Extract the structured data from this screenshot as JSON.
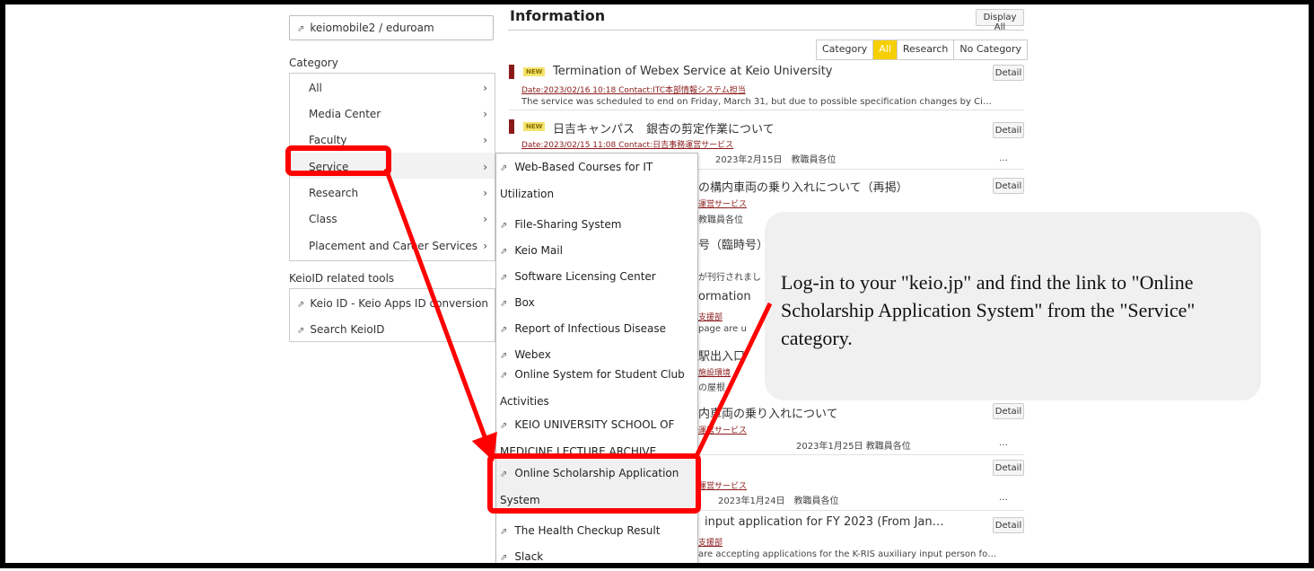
{
  "left": {
    "wifi_label": "keiomobile2 / eduroam",
    "category_heading": "Category",
    "categories": [
      "All",
      "Media Center",
      "Faculty",
      "Service",
      "Research",
      "Class",
      "Placement and Career Services"
    ],
    "tools_heading": "KeioID related tools",
    "tools": [
      "Keio ID - Keio Apps ID conversion",
      "Search KeioID"
    ]
  },
  "submenu": {
    "items": [
      "Web-Based Courses for IT Utilization",
      "File-Sharing System",
      "Keio Mail",
      "Software Licensing Center",
      "Box",
      "Report of Infectious Disease",
      "Webex",
      "Online System for Student Club Activities",
      "KEIO UNIVERSITY SCHOOL OF MEDICINE LECTURE ARCHIVE",
      "Online Scholarship Application System",
      "The Health Checkup Result",
      "Slack"
    ]
  },
  "info": {
    "title": "Information",
    "display_all": "Display All",
    "filters": [
      "Category",
      "All",
      "Research",
      "No Category"
    ],
    "detail_label": "Detail",
    "new_badge": "NEW",
    "news": [
      {
        "title": "Termination of Webex Service at Keio University",
        "meta": "Date:2023/02/16 10:18   Contact:ITC本部情報システム担当",
        "summary": "The service was scheduled to end on Friday, March 31, but due to possible specification changes by Ci…"
      },
      {
        "title": "日吉キャンパス　銀杏の剪定作業について",
        "meta": "Date:2023/02/15 11:08   Contact:日吉事務運営サービス",
        "summary": "2023年2月15日　教職員各位"
      }
    ],
    "fragments": {
      "f1_title": "の構内車両の乗り入れについて（再掲）",
      "f1_link": "運営サービス",
      "f1_text": "教職員各位",
      "f2_title": "号（臨時号）の",
      "f2_text": "が刊行されまし",
      "f3_title": "ormation",
      "f3_link": "支援部",
      "f3_text": "page are u",
      "f4_title": "駅出入口",
      "f4_link": "施設環境",
      "f4_text": "の屋根",
      "f5_title": "内車両の乗り入れについて",
      "f5_link": "運営サービス",
      "f5_text": "2023年1月25日 教職員各位",
      "f6_link": "運営サービス",
      "f6_text": "2023年1月24日　教職員各位",
      "f7_title": "input application for FY 2023 (From Jan…",
      "f7_link": "支援部",
      "f7_text": "are accepting applications for the K-RIS auxiliary input person fo…",
      "ellipsis": "…"
    }
  },
  "callout": {
    "text": "Log-in to your \"keio.jp\" and find the link to \"Online Scholarship Application System\" from the \"Service\" category."
  },
  "colors": {
    "highlight": "#ff0000",
    "accent_yellow": "#f6cf00",
    "news_bar": "#8a1a1a"
  }
}
